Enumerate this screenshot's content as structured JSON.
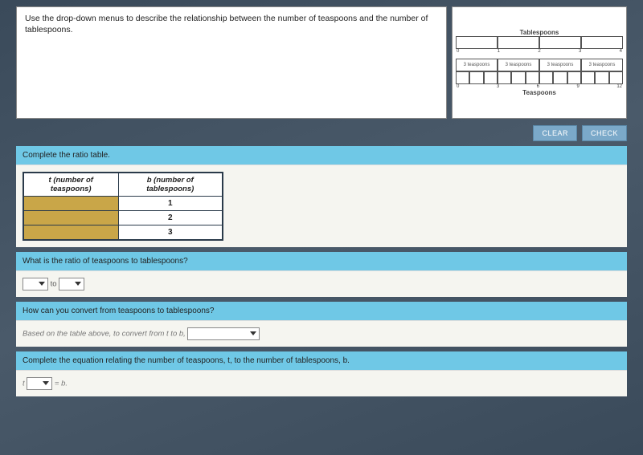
{
  "instruction": "Use the drop-down menus to describe the relationship between the number of teaspoons and the number of tablespoons.",
  "diagram": {
    "top_label": "Tablespoons",
    "bottom_label": "Teaspoons",
    "top_ticks": [
      "0",
      "1",
      "2",
      "3",
      "4"
    ],
    "mid_cells": [
      "3 teaspoons",
      "3 teaspoons",
      "3 teaspoons",
      "3 teaspoons"
    ],
    "bottom_ticks": [
      "0",
      "3",
      "6",
      "9",
      "12"
    ]
  },
  "buttons": {
    "clear": "CLEAR",
    "check": "CHECK"
  },
  "q1": {
    "header": "Complete the ratio table.",
    "col1": "t (number of teaspoons)",
    "col2": "b (number of tablespoons)",
    "rows": [
      "1",
      "2",
      "3"
    ]
  },
  "q2": {
    "header": "What is the ratio of teaspoons to tablespoons?",
    "to": "to"
  },
  "q3": {
    "header": "How can you convert from teaspoons to tablespoons?",
    "hint": "Based on the table above, to convert from t to b,"
  },
  "q4": {
    "header": "Complete the equation relating the number of teaspoons, t, to the number of tablespoons, b.",
    "lhs": "t",
    "eq": "= b."
  }
}
